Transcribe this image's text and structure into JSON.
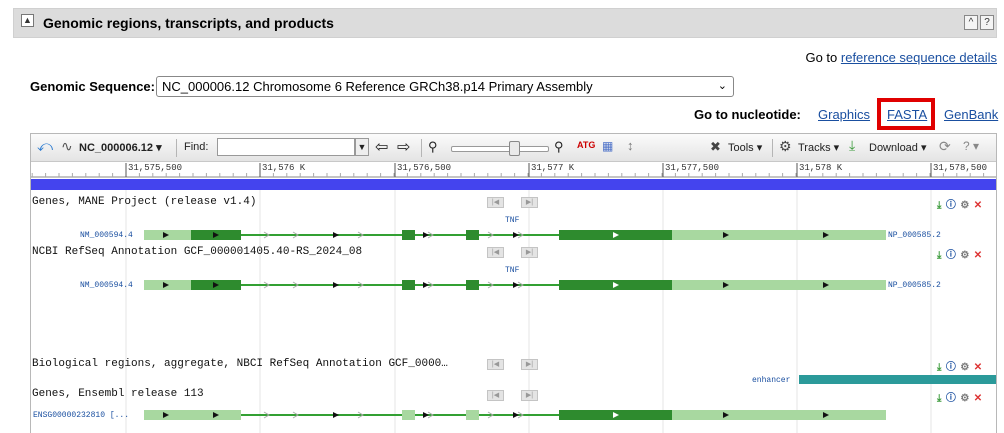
{
  "section": {
    "title": "Genomic regions, transcripts, and products",
    "collapse_icon": "▲",
    "expand_icon": "^",
    "help_icon": "?"
  },
  "goto_ref": {
    "prefix": "Go to ",
    "link": "reference sequence details"
  },
  "genomic_sequence": {
    "label": "Genomic Sequence:",
    "selected": "NC_000006.12 Chromosome 6 Reference GRCh38.p14 Primary Assembly"
  },
  "goto_nucleotide": {
    "label": "Go to nucleotide:",
    "links": [
      "Graphics",
      "FASTA",
      "GenBank"
    ],
    "highlighted": "FASTA"
  },
  "toolbar": {
    "accession": "NC_000006.12",
    "find_label": "Find:",
    "find_value": "",
    "tools_label": "Tools",
    "tracks_label": "Tracks",
    "download_label": "Download"
  },
  "ruler": {
    "ticks": [
      "31,575,500",
      "31,576 K",
      "31,576,500",
      "31,577 K",
      "31,577,500",
      "31,578 K",
      "31,578,500"
    ]
  },
  "tracks": [
    {
      "label": "Genes, MANE Project (release v1.4)",
      "gene": "TNF",
      "transcript": "NM_000594.4",
      "protein": "NP_000585.2"
    },
    {
      "label": "NCBI RefSeq Annotation GCF_000001405.40-RS_2024_08",
      "gene": "TNF",
      "transcript": "NM_000594.4",
      "protein": "NP_000585.2"
    },
    {
      "label": "Biological regions, aggregate, NBCI RefSeq Annotation GCF_0000…",
      "feature": "enhancer"
    },
    {
      "label": "Genes, Ensembl release 113",
      "transcript": "ENSG00000232810 [..."
    }
  ],
  "colors": {
    "band": "#4444ee",
    "exon_dark": "#2e8b2e",
    "exon_light": "#a8d8a0",
    "intron": "#33a033",
    "enhancer": "#2b9a9a",
    "highlight": "#e00000"
  }
}
